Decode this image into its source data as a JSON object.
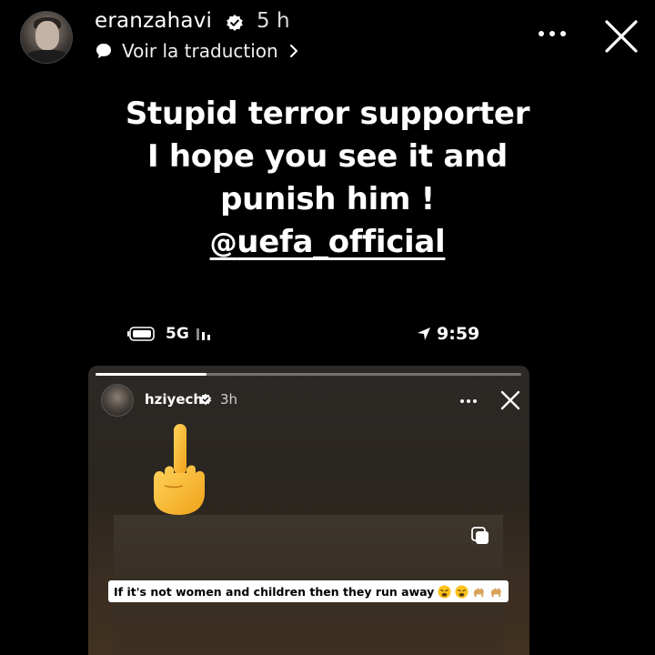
{
  "header": {
    "username": "eranzahavi",
    "time": "5 h",
    "translate_label": "Voir la traduction"
  },
  "caption": {
    "line1": "Stupid terror supporter",
    "line2": "I hope you see it and",
    "line3": "punish him !",
    "mention": "uefa_official"
  },
  "phone_status": {
    "network": "5G",
    "clock": "9:59"
  },
  "embedded_story": {
    "username": "hziyech",
    "time": "3h",
    "progress": 0.26,
    "sticker_text": "If it's not women and children then they run away"
  },
  "colors": {
    "background": "#000000",
    "verified": "#ffffff",
    "sticker_bg": "#ffffff"
  }
}
